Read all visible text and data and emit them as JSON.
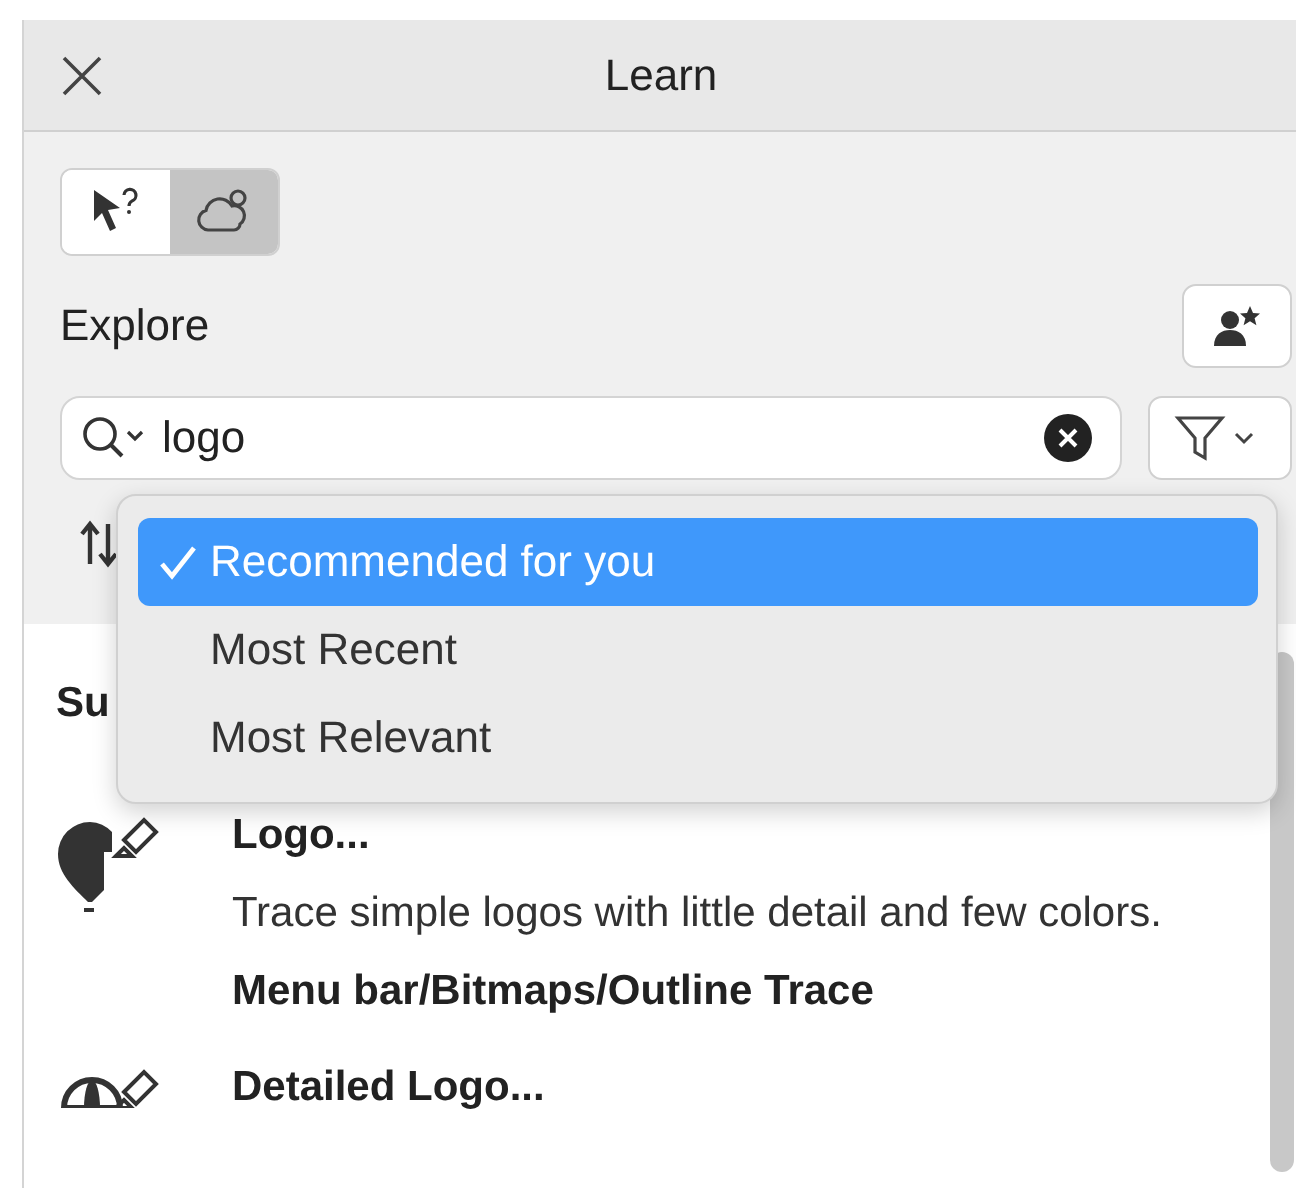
{
  "window": {
    "title": "Learn"
  },
  "mode_switch": [
    {
      "kind": "cursor-help",
      "selected": false
    },
    {
      "kind": "learn",
      "selected": true
    }
  ],
  "explore": {
    "label": "Explore"
  },
  "search": {
    "value": "logo"
  },
  "sort_menu": {
    "options": [
      {
        "label": "Recommended for you",
        "selected": true
      },
      {
        "label": "Most Recent",
        "selected": false
      },
      {
        "label": "Most Relevant",
        "selected": false
      }
    ]
  },
  "section": {
    "heading": "Su"
  },
  "results": [
    {
      "kind": "logo",
      "title": "Logo...",
      "description": "Trace simple logos with little detail and few colors.",
      "path": "Menu bar/Bitmaps/Outline Trace"
    },
    {
      "kind": "detailed-logo",
      "title": "Detailed Logo..."
    }
  ]
}
